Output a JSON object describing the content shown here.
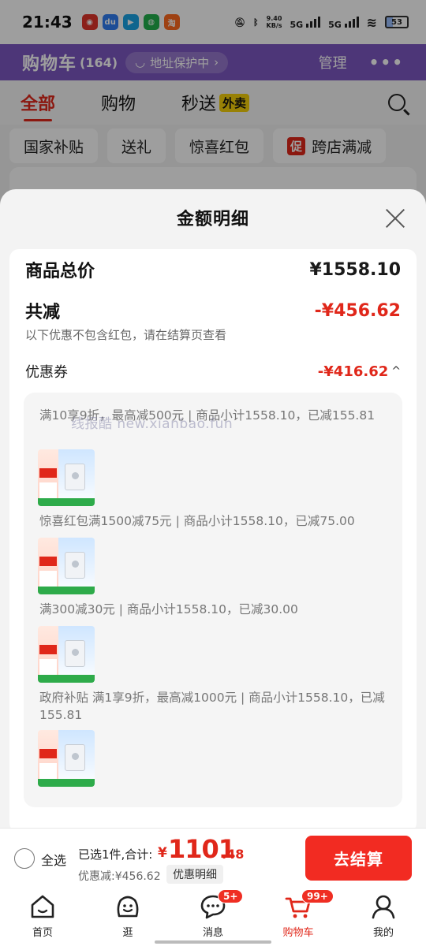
{
  "status_bar": {
    "time": "21:43",
    "net_speed_value": "9.40",
    "net_speed_unit": "KB/s",
    "signal1": "5G",
    "signal2": "5G",
    "battery": "53",
    "app_icons": [
      "netease-music-icon",
      "app-du-icon",
      "app-video-icon",
      "wechat-icon",
      "taobao-icon"
    ]
  },
  "header": {
    "title": "购物车",
    "count": "(164)",
    "address_protect": "地址保护中",
    "manage": "管理"
  },
  "tabs": [
    {
      "label": "全部",
      "active": true
    },
    {
      "label": "购物",
      "active": false
    },
    {
      "label": "秒送",
      "badge": "外卖",
      "active": false
    }
  ],
  "filters": [
    {
      "label": "国家补贴"
    },
    {
      "label": "送礼"
    },
    {
      "label": "惊喜红包"
    },
    {
      "label": "跨店满减",
      "tag": "促"
    }
  ],
  "sheet": {
    "title": "金额明细",
    "total_label": "商品总价",
    "total_value": "¥1558.10",
    "reduce_label": "共减",
    "reduce_value": "-¥456.62",
    "reduce_note": "以下优惠不包含红包，请在结算页查看",
    "coupon_label": "优惠券",
    "coupon_value": "-¥416.62",
    "coupon_caret": "^",
    "coupons": [
      {
        "text": "满10享9折，最高减500元 | 商品小计1558.10，已减155.81"
      },
      {
        "text": "惊喜红包满1500减75元 | 商品小计1558.10，已减75.00"
      },
      {
        "text": "满300减30元 | 商品小计1558.10，已减30.00"
      },
      {
        "text": "政府补贴 满1享9折，最高减1000元 | 商品小计1558.10，已减155.81"
      }
    ],
    "watermark": "线报酷 new.xianbao.fun"
  },
  "summary": {
    "select_all": "全选",
    "selected_text": "已选1件,合计:",
    "currency": "¥",
    "total_int": "1101",
    "total_dec": ".48",
    "discount_text": "优惠减:¥456.62",
    "detail_button": "优惠明细",
    "checkout_button": "去结算"
  },
  "nav": [
    {
      "label": "首页",
      "icon": "home-icon"
    },
    {
      "label": "逛",
      "icon": "stroll-face-icon"
    },
    {
      "label": "消息",
      "icon": "message-icon",
      "badge": "5+"
    },
    {
      "label": "购物车",
      "icon": "cart-icon",
      "badge": "99+",
      "active": true
    },
    {
      "label": "我的",
      "icon": "profile-icon"
    }
  ],
  "colors": {
    "accent_red": "#e0271a",
    "header_purple": "#7d57c2",
    "checkout_red": "#f22b22"
  }
}
